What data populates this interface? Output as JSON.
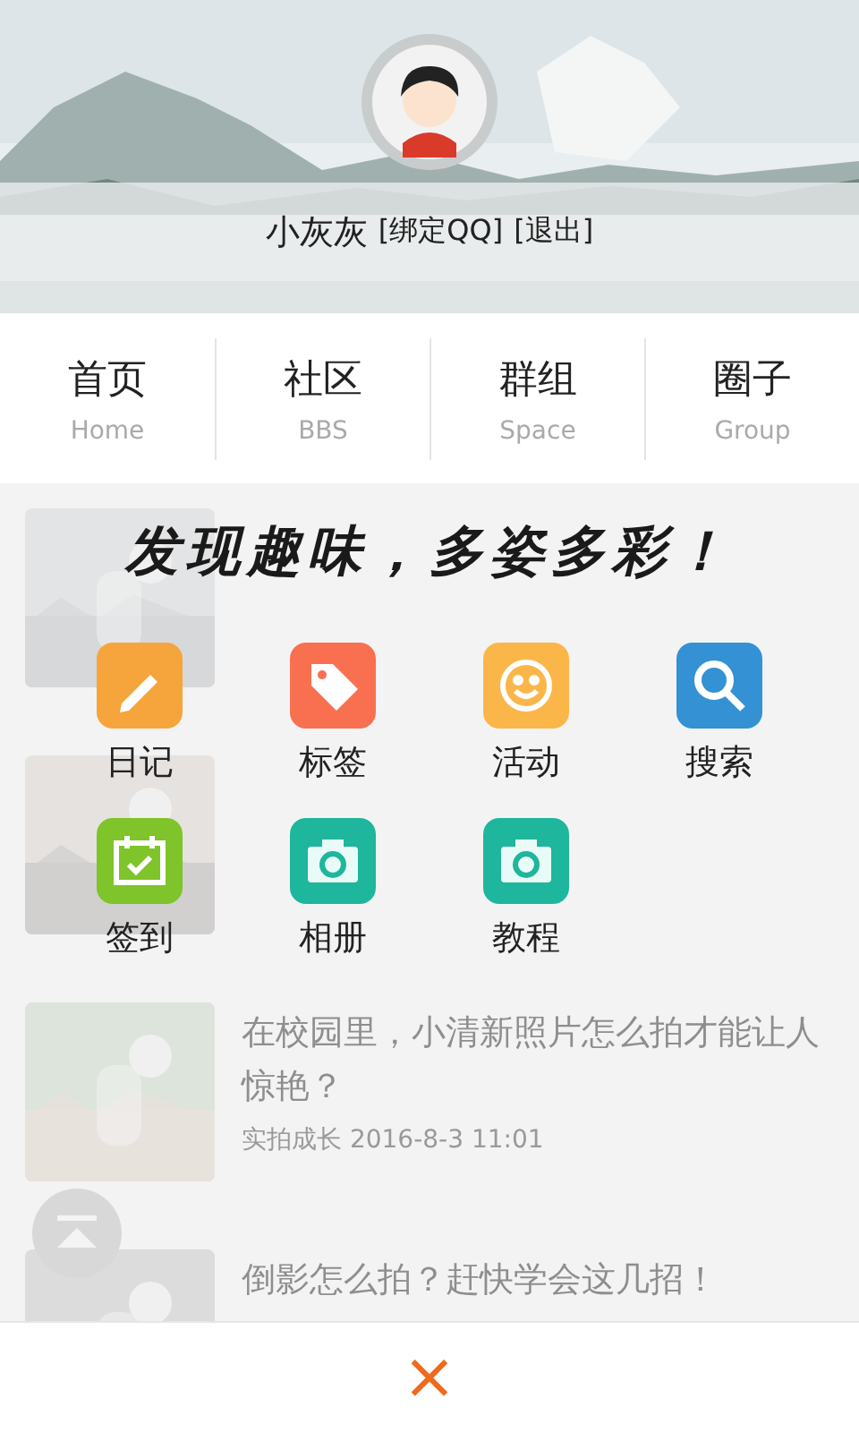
{
  "profile": {
    "name": "小灰灰",
    "links": [
      "[绑定QQ]",
      "[退出]"
    ]
  },
  "nav": [
    {
      "label": "首页",
      "sub": "Home"
    },
    {
      "label": "社区",
      "sub": "BBS"
    },
    {
      "label": "群组",
      "sub": "Space"
    },
    {
      "label": "圈子",
      "sub": "Group"
    }
  ],
  "articles": [
    {
      "kind": "picture"
    },
    {
      "kind": "picture"
    },
    {
      "title": "在校园里，小清新照片怎么拍才能让人惊艳？",
      "meta": "实拍成长 2016-8-3 11:01"
    },
    {
      "title": "倒影怎么拍？赶快学会这几招！"
    }
  ],
  "menu": {
    "slogan": "发现趣味，多姿多彩！",
    "items": [
      {
        "label": "日记",
        "kind": "pencil",
        "color": "#f6a53c"
      },
      {
        "label": "标签",
        "kind": "tag",
        "color": "#f8704f"
      },
      {
        "label": "活动",
        "kind": "smile",
        "color": "#fbb64a"
      },
      {
        "label": "搜索",
        "kind": "search",
        "color": "#3391d4"
      },
      {
        "label": "签到",
        "kind": "calendar",
        "color": "#7ec42a"
      },
      {
        "label": "相册",
        "kind": "camera",
        "color": "#1eb69c"
      },
      {
        "label": "教程",
        "kind": "camera",
        "color": "#1eb69c"
      }
    ],
    "close": "×"
  }
}
